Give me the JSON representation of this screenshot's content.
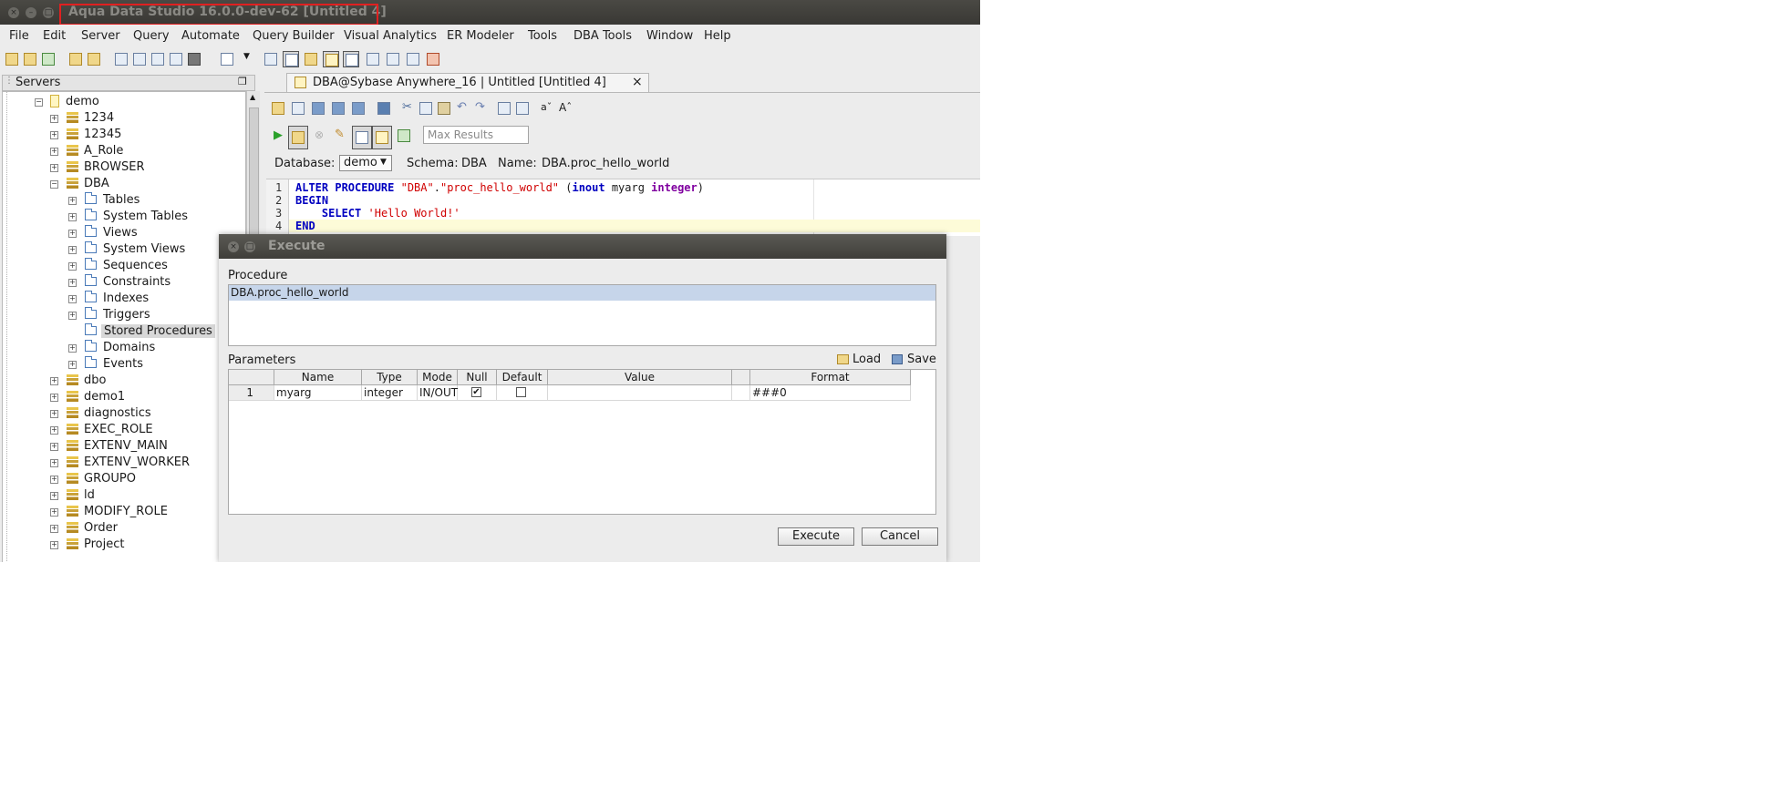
{
  "window": {
    "title": "Aqua Data Studio 16.0.0-dev-62 [Untitled 4]"
  },
  "menu": [
    "File",
    "Edit",
    "Server",
    "Query",
    "Automate",
    "Query Builder",
    "Visual Analytics",
    "ER Modeler",
    "Tools",
    "DBA Tools",
    "Window",
    "Help"
  ],
  "servers_panel": {
    "title": "Servers"
  },
  "tree": {
    "root": "demo",
    "schemas_before": [
      "1234",
      "12345",
      "A_Role",
      "BROWSER"
    ],
    "open_schema": "DBA",
    "folders": [
      "Tables",
      "System Tables",
      "Views",
      "System Views",
      "Sequences",
      "Constraints",
      "Indexes",
      "Triggers",
      "Stored Procedures",
      "Domains",
      "Events"
    ],
    "selected_folder": "Stored Procedures",
    "schemas_after": [
      "dbo",
      "demo1",
      "diagnostics",
      "EXEC_ROLE",
      "EXTENV_MAIN",
      "EXTENV_WORKER",
      "GROUPO",
      "ld",
      "MODIFY_ROLE",
      "Order",
      "Project"
    ]
  },
  "editor": {
    "tab_label": "DBA@Sybase Anywhere_16 | Untitled [Untitled 4]",
    "tab_close": "×",
    "max_results_placeholder": "Max Results",
    "database_label": "Database:",
    "database_value": "demo",
    "schema_label": "Schema:",
    "schema_value": "DBA",
    "name_label": "Name:",
    "name_value": "DBA.proc_hello_world",
    "line_numbers": [
      "1",
      "2",
      "3",
      "4"
    ],
    "code": {
      "l1_kw": "ALTER PROCEDURE",
      "l1_s1": "\"DBA\"",
      "l1_dot": ".",
      "l1_s2": "\"proc_hello_world\"",
      "l1_p1": " (",
      "l1_inout": "inout",
      "l1_arg": " myarg ",
      "l1_type": "integer",
      "l1_p2": ")",
      "l2": "BEGIN",
      "l3_kw": "SELECT",
      "l3_str": "'Hello World!'",
      "l4": "END"
    }
  },
  "dialog": {
    "title": "Execute",
    "procedure_label": "Procedure",
    "procedure_value": "DBA.proc_hello_world",
    "parameters_label": "Parameters",
    "load_label": "Load",
    "save_label": "Save",
    "columns": [
      "Name",
      "Type",
      "Mode",
      "Null",
      "Default",
      "Value",
      "Format"
    ],
    "row": {
      "index": "1",
      "name": "myarg",
      "type": "integer",
      "mode": "IN/OUT",
      "null_checked": true,
      "default_checked": false,
      "value": "",
      "format": "###0"
    },
    "execute_label": "Execute",
    "cancel_label": "Cancel"
  }
}
